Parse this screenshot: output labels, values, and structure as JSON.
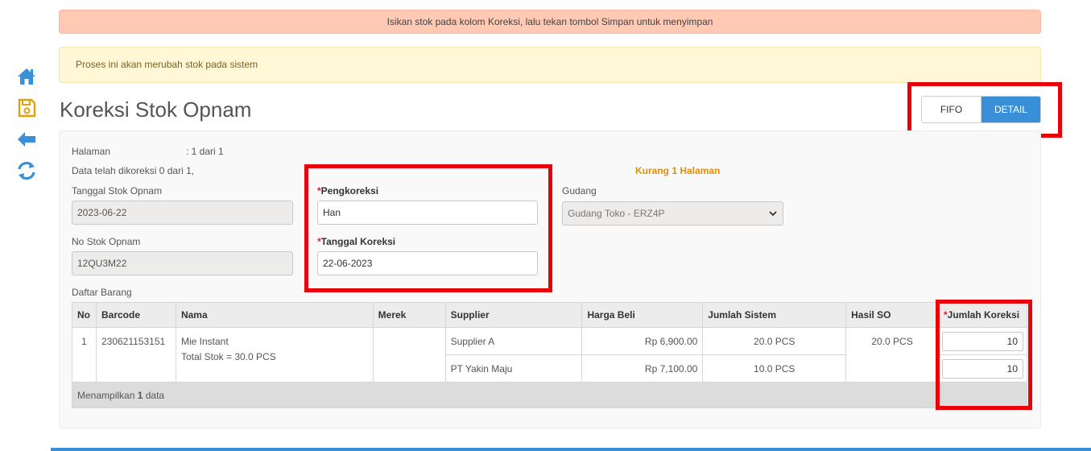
{
  "banner": {
    "info": "Isikan stok pada kolom Koreksi, lalu tekan tombol Simpan untuk menyimpan",
    "warning": "Proses ini akan merubah stok pada sistem"
  },
  "page": {
    "title": "Koreksi Stok Opnam"
  },
  "toggle": {
    "fifo": "FIFO",
    "detail": "DETAIL",
    "active": "DETAIL"
  },
  "info": {
    "halaman_label": "Halaman",
    "halaman_value": ": 1 dari 1",
    "corrected_note": "Data telah dikoreksi 0 dari 1,",
    "missing_pages": "Kurang 1 Halaman"
  },
  "form": {
    "tanggal_so_label": "Tanggal Stok Opnam",
    "tanggal_so_value": "2023-06-22",
    "no_so_label": "No Stok Opnam",
    "no_so_value": "12QU3M22",
    "required_mark": "*",
    "pengkoreksi_label": "Pengkoreksi",
    "pengkoreksi_value": "Han",
    "tanggal_koreksi_label": "Tanggal Koreksi",
    "tanggal_koreksi_value": "22-06-2023",
    "gudang_label": "Gudang",
    "gudang_value": "Gudang Toko - ERZ4P"
  },
  "table": {
    "section_label": "Daftar Barang",
    "headers": {
      "no": "No",
      "barcode": "Barcode",
      "nama": "Nama",
      "merek": "Merek",
      "supplier": "Supplier",
      "harga_beli": "Harga Beli",
      "jumlah_sistem": "Jumlah Sistem",
      "hasil_so": "Hasil SO",
      "jumlah_koreksi": "Jumlah Koreksi"
    },
    "row": {
      "no": "1",
      "barcode": "230621153151",
      "nama": "Mie Instant",
      "total_stok": "Total Stok = 30.0 PCS",
      "merek": "",
      "hasil_so": "20.0 PCS",
      "suppliers": [
        {
          "supplier": "Supplier A",
          "harga_beli": "Rp 6,900.00",
          "jumlah_sistem": "20.0 PCS",
          "koreksi": "10"
        },
        {
          "supplier": "PT Yakin Maju",
          "harga_beli": "Rp 7,100.00",
          "jumlah_sistem": "10.0 PCS",
          "koreksi": "10"
        }
      ]
    },
    "footer_prefix": "Menampilkan",
    "footer_count": "1",
    "footer_suffix": "data"
  },
  "colors": {
    "accent": "#3a8fd9",
    "highlight": "#e8000b",
    "save_icon": "#e0a20b",
    "warning_text": "#e08e0b"
  },
  "icons": [
    "home-icon",
    "save-icon",
    "back-arrow-icon",
    "refresh-icon"
  ]
}
